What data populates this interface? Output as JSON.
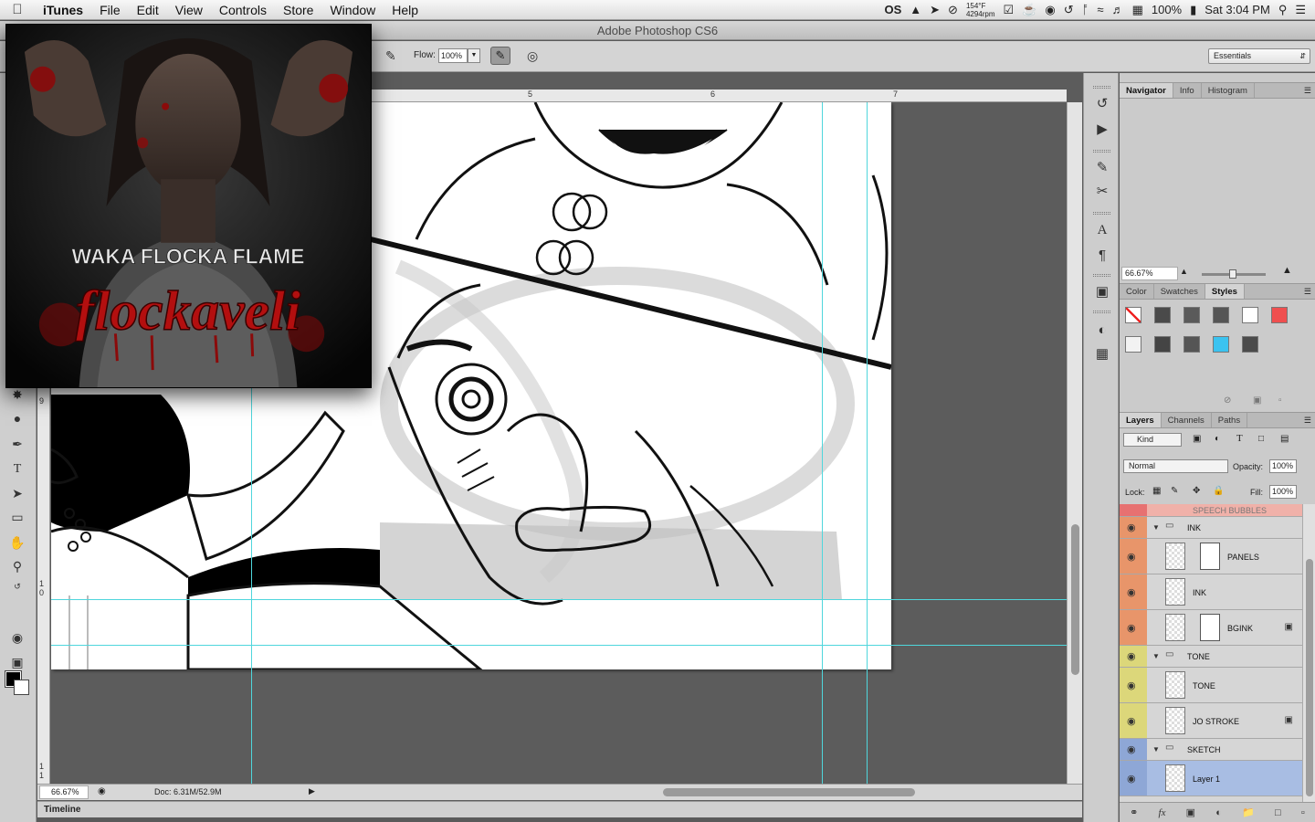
{
  "menubar": {
    "app_name": "iTunes",
    "items": [
      "File",
      "Edit",
      "View",
      "Controls",
      "Store",
      "Window",
      "Help"
    ],
    "status_temp": "154°F",
    "status_rpm": "4294rpm",
    "battery": "100%",
    "clock": "Sat 3:04 PM",
    "os_badge": "OS"
  },
  "window": {
    "title": "Adobe Photoshop CS6"
  },
  "options_bar": {
    "flow_label": "Flow:",
    "flow_value": "100%"
  },
  "workspace": {
    "value": "Essentials"
  },
  "rulers": {
    "top": [
      "5",
      "6",
      "7"
    ],
    "left": [
      "9",
      "1",
      "0",
      "1",
      "1"
    ]
  },
  "status_bar": {
    "zoom": "66.67%",
    "doc_info": "Doc: 6.31M/52.9M"
  },
  "timeline": {
    "label": "Timeline"
  },
  "itunes_art": {
    "artist": "WAKA FLOCKA FLAME",
    "album": "flockaveli"
  },
  "navigator": {
    "tabs": [
      "Navigator",
      "Info",
      "Histogram"
    ],
    "zoom": "66.67%"
  },
  "color_panel": {
    "tabs": [
      "Color",
      "Swatches",
      "Styles"
    ],
    "styles": [
      "#ffffff",
      "#4a4a4a",
      "#5a5a5a",
      "#555555",
      "#ffffff",
      "#ef4f4f",
      "#f2f2f2",
      "#444444",
      "#555555",
      "#3bc3f0",
      "#4b4b4b"
    ]
  },
  "layers_panel": {
    "tabs": [
      "Layers",
      "Channels",
      "Paths"
    ],
    "kind_label": "Kind",
    "blend_mode": "Normal",
    "opacity_label": "Opacity:",
    "opacity": "100%",
    "lock_label": "Lock:",
    "fill_label": "Fill:",
    "fill": "100%",
    "partial_layer": "SPEECH BUBBLES",
    "layers": [
      {
        "name": "INK",
        "type": "group",
        "color": "#e8956a"
      },
      {
        "name": "PANELS",
        "type": "layer",
        "color": "#e8956a"
      },
      {
        "name": "INK",
        "type": "layer",
        "color": "#e8956a"
      },
      {
        "name": "BGINK",
        "type": "layer",
        "color": "#e8956a"
      },
      {
        "name": "TONE",
        "type": "group",
        "color": "#dcd77a"
      },
      {
        "name": "TONE",
        "type": "layer",
        "color": "#dcd77a"
      },
      {
        "name": "JO STROKE",
        "type": "layer",
        "color": "#dcd77a"
      },
      {
        "name": "SKETCH",
        "type": "group",
        "color": "#8ea7d6"
      },
      {
        "name": "Layer 1",
        "type": "layer",
        "color": "#8ea7d6"
      }
    ]
  }
}
